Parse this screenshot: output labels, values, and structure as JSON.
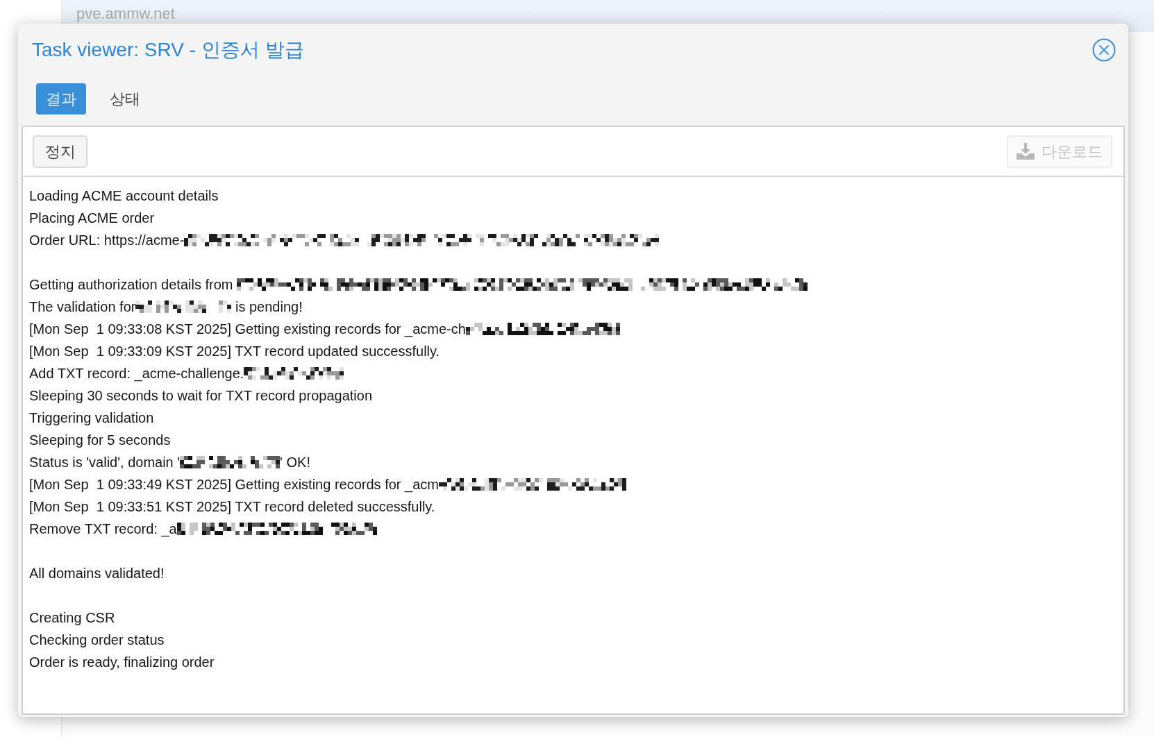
{
  "background": {
    "site_title": "pve.ammw.net"
  },
  "dialog": {
    "title": "Task viewer: SRV - 인증서 발급",
    "tabs": [
      {
        "label": "결과",
        "selected": true
      },
      {
        "label": "상태",
        "selected": false
      }
    ],
    "toolbar": {
      "stop_button": {
        "label": "정지",
        "disabled": false
      },
      "download_button": {
        "label": "다운로드",
        "disabled": true
      }
    },
    "log_blocks": [
      [
        {
          "segments": [
            {
              "kind": "text",
              "text": "Loading ACME account details"
            }
          ]
        },
        {
          "segments": [
            {
              "kind": "text",
              "text": "Placing ACME order"
            }
          ]
        },
        {
          "segments": [
            {
              "kind": "text",
              "text": "Order URL: https://acme-"
            },
            {
              "kind": "redacted"
            }
          ]
        }
      ],
      [
        {
          "segments": [
            {
              "kind": "text",
              "text": "Getting authorization details from "
            },
            {
              "kind": "redacted"
            }
          ]
        },
        {
          "segments": [
            {
              "kind": "text",
              "text": "The validation for"
            },
            {
              "kind": "redacted"
            },
            {
              "kind": "text",
              "text": " is pending!"
            }
          ]
        },
        {
          "segments": [
            {
              "kind": "text",
              "text": "[Mon Sep  1 09:33:08 KST 2025] Getting existing records for _acme-ch"
            },
            {
              "kind": "redacted"
            }
          ]
        },
        {
          "segments": [
            {
              "kind": "text",
              "text": "[Mon Sep  1 09:33:09 KST 2025] TXT record updated successfully."
            }
          ]
        },
        {
          "segments": [
            {
              "kind": "text",
              "text": "Add TXT record: _acme-challenge."
            },
            {
              "kind": "redacted"
            }
          ]
        },
        {
          "segments": [
            {
              "kind": "text",
              "text": "Sleeping 30 seconds to wait for TXT record propagation"
            }
          ]
        },
        {
          "segments": [
            {
              "kind": "text",
              "text": "Triggering validation"
            }
          ]
        },
        {
          "segments": [
            {
              "kind": "text",
              "text": "Sleeping for 5 seconds"
            }
          ]
        },
        {
          "segments": [
            {
              "kind": "text",
              "text": "Status is 'valid', domain '"
            },
            {
              "kind": "redacted"
            },
            {
              "kind": "text",
              "text": "' OK!"
            }
          ]
        },
        {
          "segments": [
            {
              "kind": "text",
              "text": "[Mon Sep  1 09:33:49 KST 2025] Getting existing records for _acm"
            },
            {
              "kind": "redacted"
            }
          ]
        },
        {
          "segments": [
            {
              "kind": "text",
              "text": "[Mon Sep  1 09:33:51 KST 2025] TXT record deleted successfully."
            }
          ]
        },
        {
          "segments": [
            {
              "kind": "text",
              "text": "Remove TXT record: _a"
            },
            {
              "kind": "redacted"
            }
          ]
        }
      ],
      [
        {
          "segments": [
            {
              "kind": "text",
              "text": "All domains validated!"
            }
          ]
        }
      ],
      [
        {
          "segments": [
            {
              "kind": "text",
              "text": "Creating CSR"
            }
          ]
        },
        {
          "segments": [
            {
              "kind": "text",
              "text": "Checking order status"
            }
          ]
        },
        {
          "segments": [
            {
              "kind": "text",
              "text": "Order is ready, finalizing order"
            }
          ]
        }
      ]
    ]
  }
}
